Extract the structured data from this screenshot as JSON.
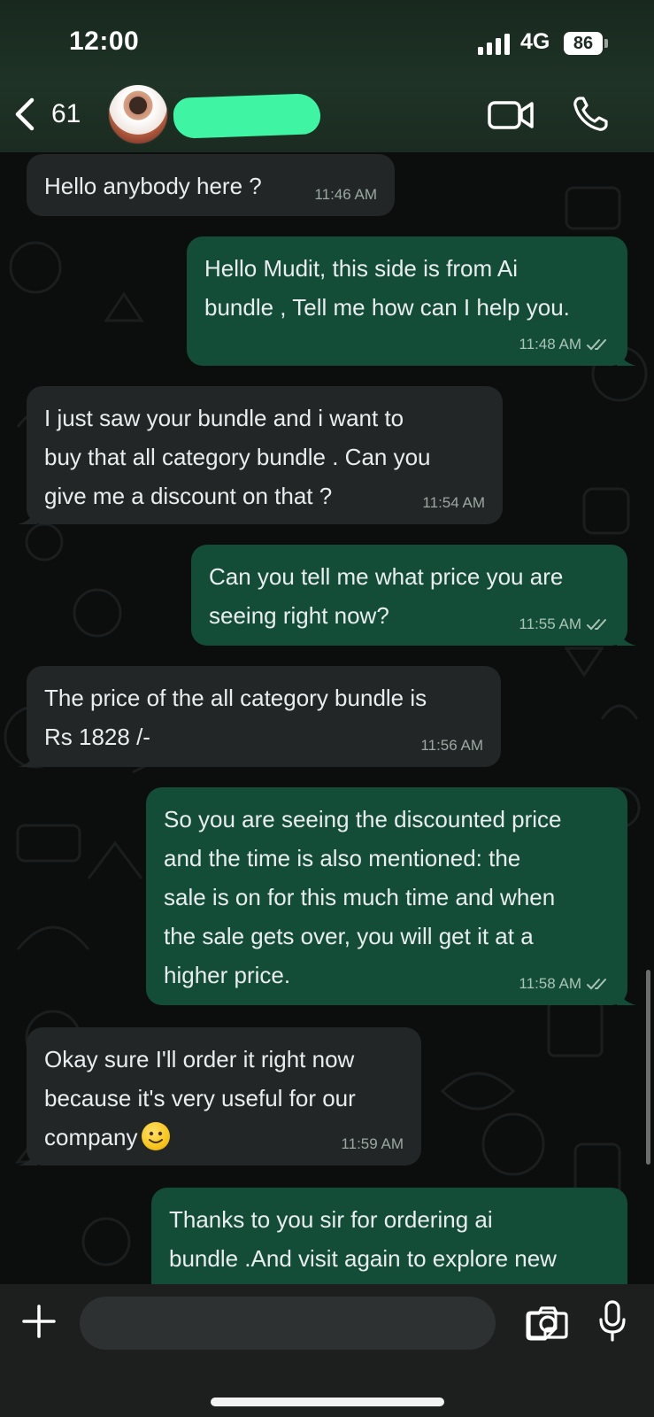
{
  "status_bar": {
    "time": "12:00",
    "network": "4G",
    "battery": "86"
  },
  "header": {
    "back_count": "61",
    "icons": [
      "chevron-left-icon",
      "video-call-icon",
      "phone-icon"
    ]
  },
  "messages": [
    {
      "direction": "in",
      "text": "Hello anybody here ?",
      "time": "11:46 AM"
    },
    {
      "direction": "out",
      "text": "Hello Mudit, this side is from Ai\nbundle , Tell me how can I help you.",
      "time": "11:48 AM",
      "read": true
    },
    {
      "direction": "in",
      "text": "I just saw your bundle and i want to\nbuy that all category bundle . Can you\ngive me a discount on that ?",
      "time": "11:54 AM"
    },
    {
      "direction": "out",
      "text": "Can you tell me what price you are\nseeing right now?",
      "time": "11:55 AM",
      "read": true
    },
    {
      "direction": "in",
      "text": "The price of the all category bundle is\nRs 1828 /-",
      "time": "11:56 AM"
    },
    {
      "direction": "out",
      "text": "So you are seeing the discounted price\nand the time is also mentioned: the\nsale is on for this much time and when\nthe sale gets over, you will get it at a\nhigher price.",
      "time": "11:58 AM",
      "read": true
    },
    {
      "direction": "in",
      "text": "Okay sure I'll order it right now\nbecause it's very useful for our\ncompany",
      "emoji": "slightly-smiling-face",
      "time": "11:59 AM"
    },
    {
      "direction": "out",
      "text": "Thanks to you sir for ordering ai\nbundle .And visit again to explore new",
      "time": "",
      "read": true,
      "partial": true
    }
  ],
  "composer": {
    "value": "",
    "placeholder": "",
    "icons": [
      "plus-icon",
      "sticker-icon",
      "camera-icon",
      "microphone-icon"
    ]
  },
  "colors": {
    "incoming_bubble": "#232626",
    "outgoing_bubble": "#144d37",
    "header_bg": "#1f3326",
    "redaction": "#3ff5a3"
  }
}
